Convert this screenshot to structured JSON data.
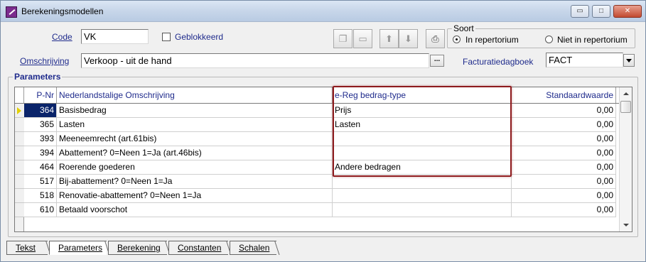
{
  "window": {
    "title": "Berekeningsmodellen",
    "buttons": {
      "minimize": "▭",
      "maximize": "□",
      "close": "✕"
    }
  },
  "form": {
    "code_label": "Code",
    "code_value": "VK",
    "geblokkeerd_label": "Geblokkeerd",
    "omschrijving_label": "Omschrijving",
    "omschrijving_value": "Verkoop - uit de hand",
    "omschrijving_button": "...",
    "factuur_label": "Facturatiedagboek",
    "factuur_value": "FACT"
  },
  "soort": {
    "title": "Soort",
    "options": [
      {
        "label": "In repertorium",
        "selected": true
      },
      {
        "label": "Niet in repertorium",
        "selected": false
      }
    ]
  },
  "toolbar": {
    "icons": [
      "copy-icon",
      "window-icon",
      "up-arrow-icon",
      "down-arrow-icon",
      "print-icon"
    ]
  },
  "parameters": {
    "title": "Parameters",
    "columns": [
      "P-Nr",
      "Nederlandstalige Omschrijving",
      "e-Reg bedrag-type",
      "Standaardwaarde"
    ],
    "rows": [
      {
        "nr": "364",
        "desc": "Basisbedrag",
        "type": "Prijs",
        "value": "0,00",
        "selected": true
      },
      {
        "nr": "365",
        "desc": "Lasten",
        "type": "Lasten",
        "value": "0,00"
      },
      {
        "nr": "393",
        "desc": "Meeneemrecht (art.61bis)",
        "type": "",
        "value": "0,00"
      },
      {
        "nr": "394",
        "desc": "Abattement? 0=Neen 1=Ja (art.46bis)",
        "type": "",
        "value": "0,00"
      },
      {
        "nr": "464",
        "desc": "Roerende goederen",
        "type": "Andere bedragen",
        "value": "0,00"
      },
      {
        "nr": "517",
        "desc": "Bij-abattement? 0=Neen 1=Ja",
        "type": "",
        "value": "0,00"
      },
      {
        "nr": "518",
        "desc": "Renovatie-abattement? 0=Neen 1=Ja",
        "type": "",
        "value": "0,00"
      },
      {
        "nr": "610",
        "desc": "Betaald voorschot",
        "type": "",
        "value": "0,00"
      }
    ]
  },
  "tabs": [
    {
      "label": "Tekst",
      "active": false
    },
    {
      "label": "Parameters",
      "active": true
    },
    {
      "label": "Berekening",
      "active": false
    },
    {
      "label": "Constanten",
      "active": false
    },
    {
      "label": "Schalen",
      "active": false
    }
  ],
  "colors": {
    "highlight": "#8e1b1e",
    "label_blue": "#1f2b8c",
    "selection": "#0a246a"
  }
}
